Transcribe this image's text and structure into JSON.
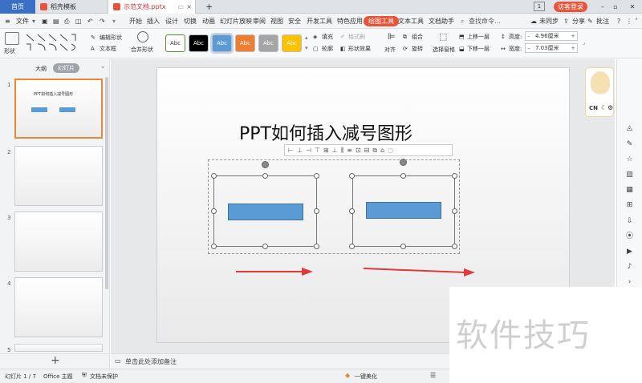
{
  "tabs": {
    "home": "首页",
    "template": "稻壳模板",
    "document": "示范文档.pptx",
    "add": "+",
    "badge": "1"
  },
  "menu": {
    "items": [
      "文件",
      "开始",
      "插入",
      "设计",
      "切换",
      "动画",
      "幻灯片放映",
      "审阅",
      "视图",
      "安全",
      "开发工具",
      "特色应用",
      "绘图工具",
      "文本工具",
      "文档助手"
    ],
    "search": "查找命令…",
    "login": "访客登录",
    "sync": "未同步",
    "share": "分享",
    "comment": "批注"
  },
  "ribbon": {
    "shape": "形状",
    "edit_shape": "编辑形状",
    "textbox": "文本框",
    "merge": "合并形状",
    "style_label": "Abc",
    "fill": "填充",
    "format_brush": "格式刷",
    "outline": "轮廓",
    "shape_effect": "形状效果",
    "align": "对齐",
    "group": "组合",
    "rotate": "旋转",
    "selection_pane": "选择窗格",
    "bring_forward": "上移一层",
    "send_backward": "下移一层",
    "height_label": "高度:",
    "height_value": "4.96厘米",
    "width_label": "宽度:",
    "width_value": "7.03厘米"
  },
  "left_panel": {
    "tab_outline": "大纲",
    "tab_slides": "幻灯片",
    "slide_numbers": [
      "1",
      "2",
      "3",
      "4",
      "5"
    ],
    "thumb1_title": "PPT如何插入减号图形",
    "add": "+"
  },
  "slide": {
    "title": "PPT如何插入减号图形"
  },
  "notes": {
    "placeholder": "单击此处添加备注"
  },
  "status": {
    "slide_counter": "幻灯片 1 / 7",
    "theme": "Office 主题",
    "protect": "文档未保护",
    "beautify": "一键美化"
  },
  "mascot": {
    "label": "CN"
  },
  "watermark": {
    "text": "软件技巧"
  },
  "colors": {
    "accent": "#e6553a",
    "shape_fill": "#5b9bd5",
    "arrow": "#e0393a"
  }
}
